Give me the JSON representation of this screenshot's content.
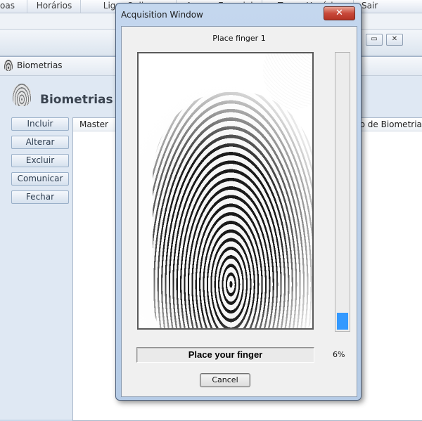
{
  "menu": {
    "items": [
      {
        "label": "oas"
      },
      {
        "label": "Horários"
      },
      {
        "label": "Ligar Online"
      },
      {
        "label": "Acesso Especial"
      },
      {
        "label": "Trocar Usuário"
      },
      {
        "label": "Sair"
      }
    ]
  },
  "child_window": {
    "title": "Biometrias",
    "heading": "Biometrias |",
    "buttons": [
      {
        "label": "Incluir"
      },
      {
        "label": "Alterar"
      },
      {
        "label": "Excluir"
      },
      {
        "label": "Comunicar"
      },
      {
        "label": "Fechar"
      }
    ],
    "columns": [
      {
        "label": "Master"
      },
      {
        "label": "po de Biometria"
      }
    ]
  },
  "dialog": {
    "title": "Acquisition Window",
    "close_symbol": "✕",
    "instruction": "Place finger 1",
    "status": "Place your finger",
    "quality_percent": 6,
    "percent_label": "6%",
    "cancel_label": "Cancel",
    "fill_color": "#3399ff",
    "icons": [
      "fingerprint-icon"
    ]
  },
  "mdi_controls": [
    {
      "symbol": "▭"
    },
    {
      "symbol": "✕"
    }
  ]
}
